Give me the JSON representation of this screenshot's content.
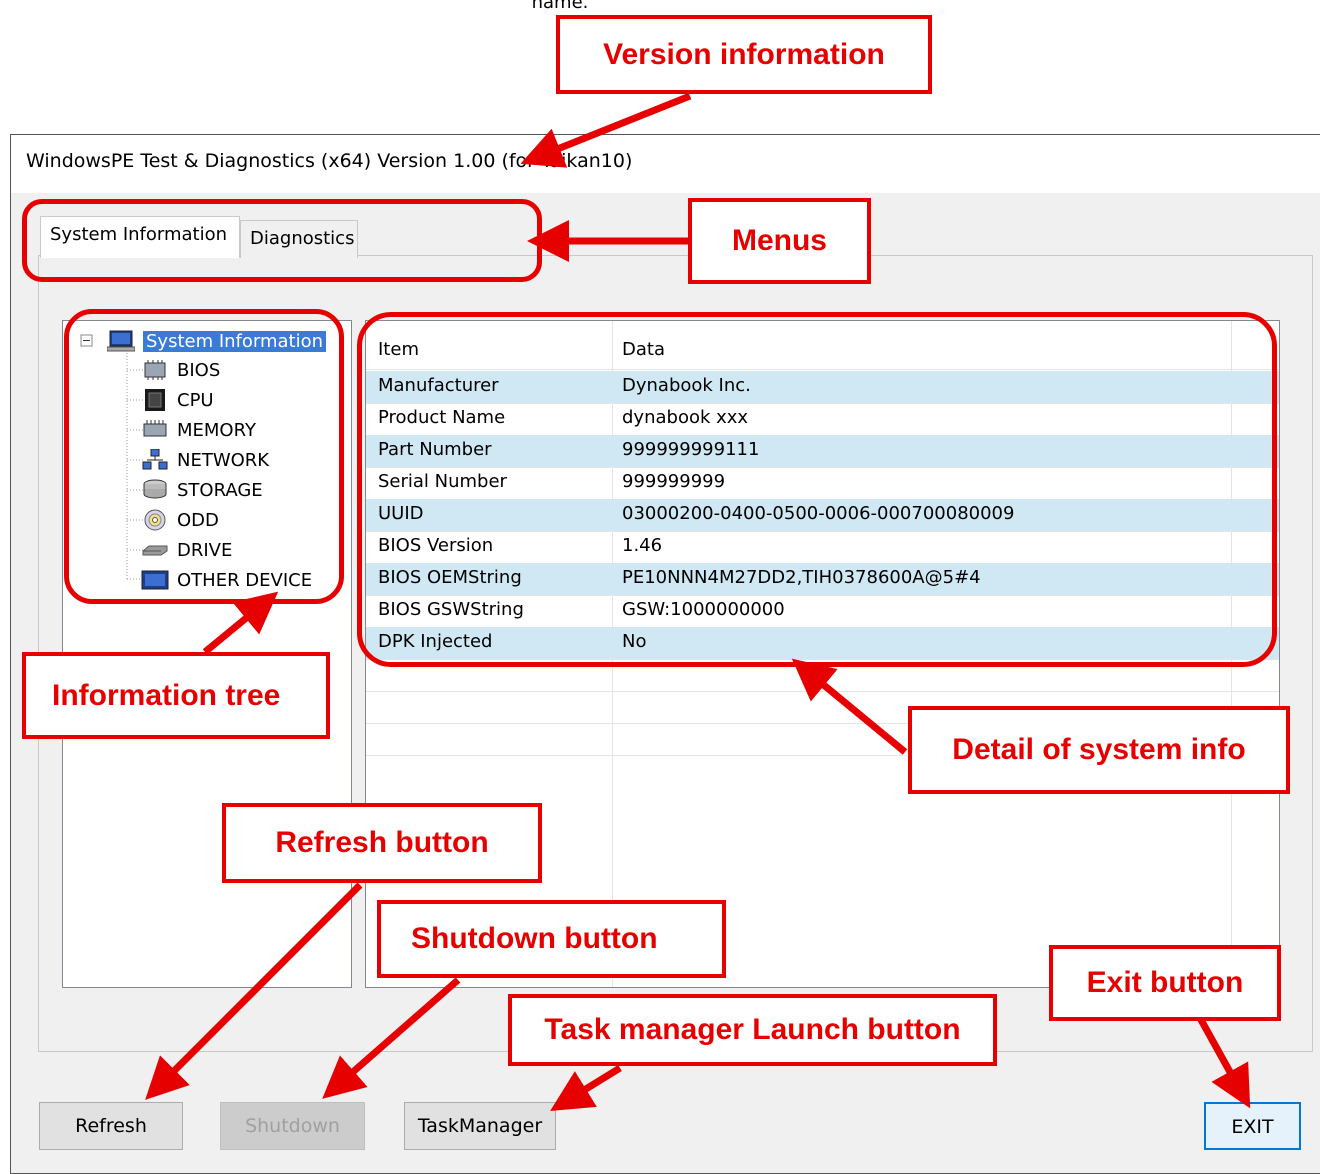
{
  "top_note": "name.",
  "window": {
    "title": "WindowsPE Test & Diagnostics (x64) Version 1.00 (for Taikan10)"
  },
  "tabs": [
    {
      "label": "System Information",
      "active": true
    },
    {
      "label": "Diagnostics",
      "active": false
    }
  ],
  "tree": {
    "root": {
      "label": "System Information",
      "icon": "computer-icon"
    },
    "items": [
      {
        "label": "BIOS",
        "icon": "chip-icon"
      },
      {
        "label": "CPU",
        "icon": "cpu-icon"
      },
      {
        "label": "MEMORY",
        "icon": "memory-icon"
      },
      {
        "label": "NETWORK",
        "icon": "network-icon"
      },
      {
        "label": "STORAGE",
        "icon": "storage-icon"
      },
      {
        "label": "ODD",
        "icon": "disc-icon"
      },
      {
        "label": "DRIVE",
        "icon": "drive-icon"
      },
      {
        "label": "OTHER DEVICE",
        "icon": "device-icon"
      }
    ]
  },
  "detail": {
    "headers": [
      "Item",
      "Data"
    ],
    "rows": [
      [
        "Manufacturer",
        "Dynabook Inc."
      ],
      [
        "Product Name",
        "dynabook xxx"
      ],
      [
        "Part Number",
        "999999999111"
      ],
      [
        "Serial Number",
        "999999999"
      ],
      [
        "UUID",
        "03000200-0400-0500-0006-000700080009"
      ],
      [
        "BIOS Version",
        "1.46"
      ],
      [
        "BIOS OEMString",
        "PE10NNN4M27DD2,TIH0378600A@5#4"
      ],
      [
        "BIOS GSWString",
        "GSW:1000000000"
      ],
      [
        "DPK Injected",
        "No"
      ]
    ]
  },
  "buttons": {
    "refresh": "Refresh",
    "shutdown": "Shutdown",
    "taskmanager": "TaskManager",
    "exit": "EXIT"
  },
  "callouts": {
    "version": "Version information",
    "menus": "Menus",
    "tree": "Information tree",
    "detail": "Detail of system info",
    "refresh": "Refresh button",
    "shutdown": "Shutdown button",
    "taskmanager": "Task manager Launch button",
    "exit": "Exit button"
  },
  "colors": {
    "annotation_red": "#e60000",
    "selection_blue": "#3a7bd5",
    "alt_row": "#cfe8f3"
  }
}
